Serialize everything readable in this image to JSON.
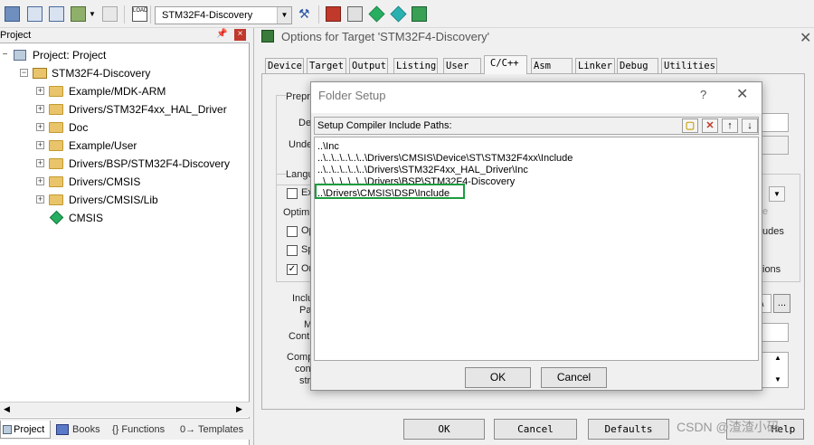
{
  "toolbar": {
    "target": "STM32F4-Discovery",
    "icons": [
      "batch-build-icon",
      "translate-icon",
      "build-icon",
      "rebuild-icon",
      "download-icon",
      "target-select-icon",
      "options-icon",
      "manage-components-icon",
      "pack-installer-icon",
      "select-software-packs-icon",
      "manage-run-time-env-icon"
    ]
  },
  "project": {
    "title": "Project",
    "tree": [
      {
        "label": "Project: Project",
        "level": 0
      },
      {
        "label": "STM32F4-Discovery",
        "level": 1
      },
      {
        "label": "Example/MDK-ARM",
        "level": 2
      },
      {
        "label": "Drivers/STM32F4xx_HAL_Driver",
        "level": 2
      },
      {
        "label": "Doc",
        "level": 2
      },
      {
        "label": "Example/User",
        "level": 2
      },
      {
        "label": "Drivers/BSP/STM32F4-Discovery",
        "level": 2
      },
      {
        "label": "Drivers/CMSIS",
        "level": 2
      },
      {
        "label": "Drivers/CMSIS/Lib",
        "level": 2
      },
      {
        "label": "CMSIS",
        "level": 2
      }
    ],
    "tabs": [
      "Project",
      "Books",
      "{} Functions",
      "0→ Templates"
    ]
  },
  "options": {
    "title": "Options for Target 'STM32F4-Discovery'",
    "tabs": [
      "Device",
      "Target",
      "Output",
      "Listing",
      "User",
      "C/C++",
      "Asm",
      "Linker",
      "Debug",
      "Utilities"
    ],
    "active_tab": "C/C++",
    "partial_labels": {
      "preproc": "Preproc",
      "def": "Def",
      "undef": "Undef",
      "langu": "Langu",
      "ex": "Ex",
      "optimiz": "Optimiz",
      "op": "Op",
      "sp": "Sp",
      "on": "On",
      "inclu": "Inclu",
      "pat": "Pat",
      "m": "M",
      "contr": "Contr",
      "comp": "Comp",
      "cont": "cont",
      "str": "str",
      "e": "e",
      "udes": "udes",
      "ions": "ions"
    },
    "buttons": {
      "ok": "OK",
      "cancel": "Cancel",
      "defaults": "Defaults",
      "help": "Help",
      "browse": "..."
    }
  },
  "folder_setup": {
    "title": "Folder Setup",
    "help": "?",
    "header_label": "Setup Compiler Include Paths:",
    "paths": [
      "..\\Inc",
      "..\\..\\..\\..\\..\\..\\Drivers\\CMSIS\\Device\\ST\\STM32F4xx\\Include",
      "..\\..\\..\\..\\..\\..\\Drivers\\STM32F4xx_HAL_Driver\\Inc",
      "..\\..\\..\\..\\..\\..\\Drivers\\BSP\\STM32F4-Discovery",
      "..\\Drivers\\CMSIS\\DSP\\Include"
    ],
    "highlight_color": "#1a9c3e",
    "ok": "OK",
    "cancel": "Cancel"
  },
  "watermark": "CSDN @渣渣小码"
}
